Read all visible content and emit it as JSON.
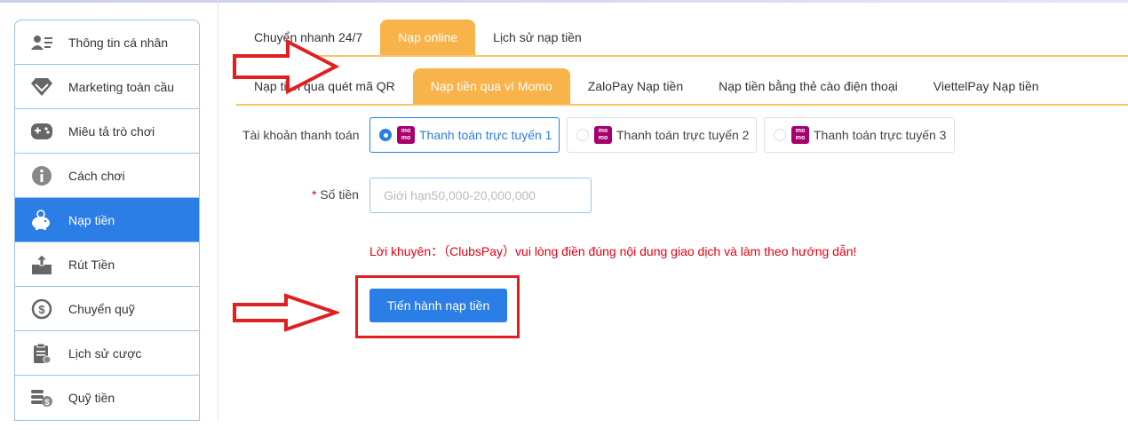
{
  "sidebar": {
    "items": [
      {
        "label": "Thông tin cá nhân",
        "icon": "user-card-icon",
        "active": false
      },
      {
        "label": "Marketing toàn cầu",
        "icon": "diamond-icon",
        "active": false
      },
      {
        "label": "Miêu tả trò chơi",
        "icon": "gamepad-icon",
        "active": false
      },
      {
        "label": "Cách chơi",
        "icon": "info-icon",
        "active": false
      },
      {
        "label": "Nạp tiền",
        "icon": "piggy-bank-icon",
        "active": true
      },
      {
        "label": "Rút Tiền",
        "icon": "withdraw-icon",
        "active": false
      },
      {
        "label": "Chuyển quỹ",
        "icon": "transfer-icon",
        "active": false
      },
      {
        "label": "Lịch sử cược",
        "icon": "clipboard-icon",
        "active": false
      },
      {
        "label": "Quỹ tiền",
        "icon": "coins-icon",
        "active": false
      }
    ]
  },
  "tabs": [
    {
      "label": "Chuyển nhanh 24/7",
      "active": false
    },
    {
      "label": "Nạp online",
      "active": true
    },
    {
      "label": "Lịch sử nạp tiền",
      "active": false
    }
  ],
  "subtabs": [
    {
      "label": "Nạp tiền qua quét mã QR",
      "active": false
    },
    {
      "label": "Nạp tiền qua ví Momo",
      "active": true
    },
    {
      "label": "ZaloPay Nạp tiền",
      "active": false
    },
    {
      "label": "Nạp tiền bằng thẻ cào điện thoại",
      "active": false
    },
    {
      "label": "ViettelPay Nạp tiền",
      "active": false
    }
  ],
  "form": {
    "account_label": "Tài khoản thanh toán",
    "accounts": [
      {
        "label": "Thanh toán trực tuyến 1",
        "selected": true,
        "logo": "mo mo"
      },
      {
        "label": "Thanh toán trực tuyến 2",
        "selected": false,
        "logo": "mo mo"
      },
      {
        "label": "Thanh toán trực tuyến 3",
        "selected": false,
        "logo": "mo mo"
      }
    ],
    "required_mark": "*",
    "amount_label": "Số tiền",
    "amount_placeholder": "Giới hạn50,000-20,000,000",
    "tip": "Lời khuyên：（ClubsPay）vui lòng điền đúng nội dung giao dịch và làm theo hướng dẫn!",
    "submit_label": "Tiến hành nạp tiền"
  },
  "colors": {
    "accent_blue": "#2a7ee6",
    "tab_orange": "#f8b34a",
    "warning_red": "#e60012",
    "annotation_red": "#e02020"
  }
}
